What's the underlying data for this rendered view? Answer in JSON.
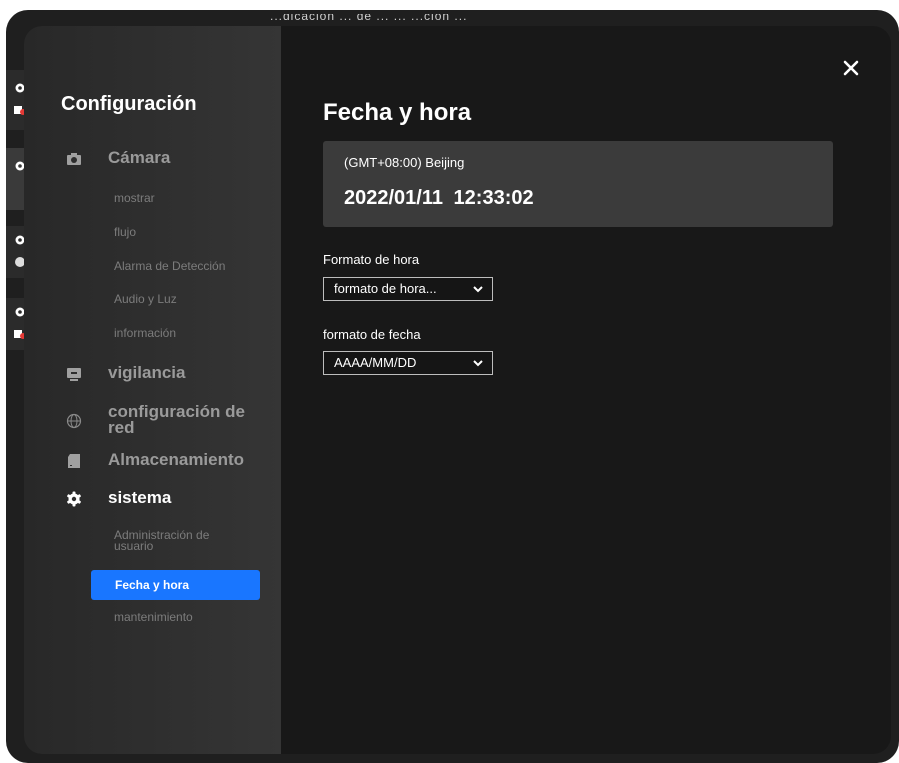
{
  "background": {
    "title_fragment": "...dicación ... de ... ... ...ción ..."
  },
  "sidebar": {
    "title": "Configuración",
    "groups": [
      {
        "label": "Cámara",
        "icon": "camera-icon"
      },
      {
        "label": "vigilancia",
        "icon": "monitor-icon"
      },
      {
        "label": "configuración de red",
        "icon": "globe-icon"
      },
      {
        "label": "Almacenamiento",
        "icon": "sd-card-icon"
      },
      {
        "label": "sistema",
        "icon": "gear-icon",
        "active": true
      }
    ],
    "camera_items": [
      "mostrar",
      "flujo",
      "Alarma de Detección",
      "Audio y Luz",
      "información"
    ],
    "system_items": [
      "Administración de usuario",
      "Fecha y hora",
      "mantenimiento"
    ]
  },
  "main": {
    "title": "Fecha y hora",
    "timezone": "(GMT+08:00) Beijing",
    "datetime": "2022/01/11 12:33:02",
    "time_format": {
      "label": "Formato de hora",
      "value": "formato de hora..."
    },
    "date_format": {
      "label": "formato de fecha",
      "value": "AAAA/MM/DD"
    }
  },
  "colors": {
    "accent": "#1976ff",
    "panel": "#181818",
    "card": "#3b3b3b"
  }
}
